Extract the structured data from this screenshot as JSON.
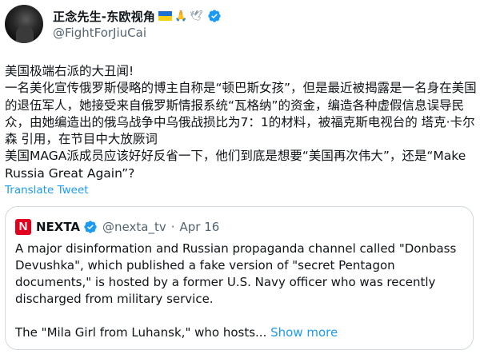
{
  "author": {
    "display_name": "正念先生-东欧视角",
    "emoji_icons": [
      "ukraine-flag-icon",
      "folded-hands-icon",
      "dove-icon"
    ],
    "emoji_text": "🙏",
    "dove_text": "🕊",
    "handle": "@FightForJiuCai",
    "verified": true
  },
  "tweet": {
    "text": "美国极端右派的大丑闻!\n一名美化宣传俄罗斯侵略的博主自称是“顿巴斯女孩”，但是最近被揭露是一名身在美国的退伍军人，她接受来自俄罗斯情报系统“瓦格纳”的资金，编造各种虚假信息误导民众，由她编造出的俄乌战争中乌俄战损比为7：1的材料，被福克斯电视台的 塔克·卡尔森 引用，在节目中大放厥词\n美国MAGA派成员应该好好反省一下，他们到底是想要“美国再次伟大”，还是“Make Russia Great Again”?",
    "translate_label": "Translate Tweet"
  },
  "quoted_tweet": {
    "avatar_letter": "N",
    "name": "NEXTA",
    "handle": "@nexta_tv",
    "separator": "·",
    "date": "Apr 16",
    "paragraph_1": "A major disinformation and Russian propaganda channel called \"Donbass Devushka\", which published a fake version of \"secret Pentagon documents,\" is hosted by a former U.S. Navy officer who was recently discharged from military service.",
    "paragraph_2": "The \"Mila Girl from Luhansk,\" who hosts... ",
    "show_more_label": "Show more"
  },
  "colors": {
    "link": "#1d9bf0",
    "secondary_text": "#536471",
    "verified_badge": "#1d9bf0",
    "nexta_red": "#e1001d"
  }
}
